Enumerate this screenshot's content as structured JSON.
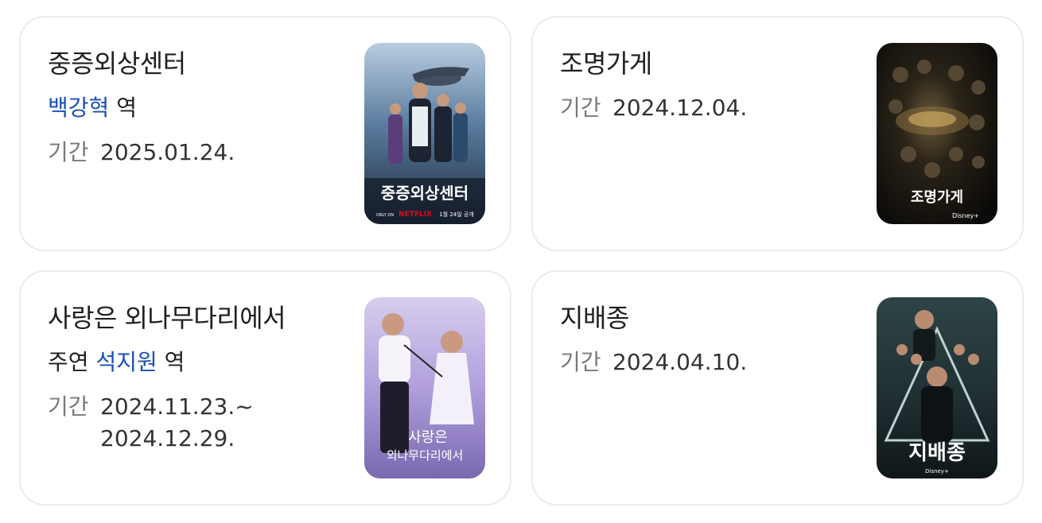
{
  "cards": [
    {
      "title": "중증외상센터",
      "role_prefix": "",
      "actor": "백강혁",
      "role_suffix": "역",
      "period_label": "기간",
      "period_lines": [
        "2025.01.24."
      ],
      "poster": {
        "title": "중증외상센터",
        "brand": "NETFLIX",
        "brand_prefix": "ONLY ON",
        "release": "1월 24일 공개",
        "colors": [
          "#9fb7cf",
          "#4f6f91",
          "#22324a"
        ]
      }
    },
    {
      "title": "조명가게",
      "role_prefix": "",
      "actor": "",
      "role_suffix": "",
      "period_label": "기간",
      "period_lines": [
        "2024.12.04."
      ],
      "poster": {
        "title": "조명가게",
        "brand": "Disney+",
        "colors": [
          "#2a2418",
          "#151310",
          "#0b0a08"
        ]
      }
    },
    {
      "title": "사랑은 외나무다리에서",
      "role_prefix": "주연",
      "actor": "석지원",
      "role_suffix": "역",
      "period_label": "기간",
      "period_lines": [
        "2024.11.23.~",
        "2024.12.29."
      ],
      "poster": {
        "title_line1": "사랑은",
        "title_line2": "외나무다리에서",
        "colors": [
          "#c7b6e8",
          "#a996d6",
          "#7c6ab3"
        ]
      }
    },
    {
      "title": "지배종",
      "role_prefix": "",
      "actor": "",
      "role_suffix": "",
      "period_label": "기간",
      "period_lines": [
        "2024.04.10."
      ],
      "poster": {
        "title": "지배종",
        "brand": "Disney+",
        "colors": [
          "#4b6262",
          "#2c3b3d",
          "#151d1f"
        ]
      }
    }
  ]
}
